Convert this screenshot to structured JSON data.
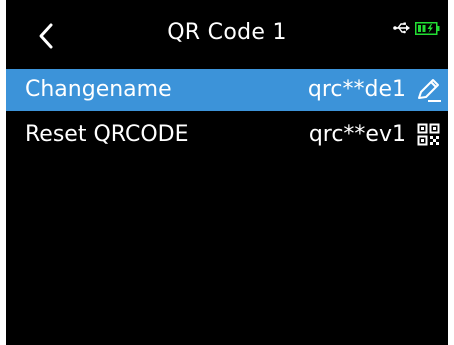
{
  "header": {
    "title": "QR Code 1",
    "back_icon": "chevron-left-icon",
    "usb_icon": "usb-icon",
    "battery_icon": "battery-charging-icon"
  },
  "menu": {
    "items": [
      {
        "label": "Changename",
        "value": "qrc**de1",
        "icon": "pencil-icon",
        "selected": true
      },
      {
        "label": "Reset QRCODE",
        "value": "qrc**ev1",
        "icon": "qr-code-icon",
        "selected": false
      }
    ]
  },
  "colors": {
    "background": "#000000",
    "highlight": "#3c93d9",
    "text": "#ffffff",
    "battery": "#22dd33"
  }
}
